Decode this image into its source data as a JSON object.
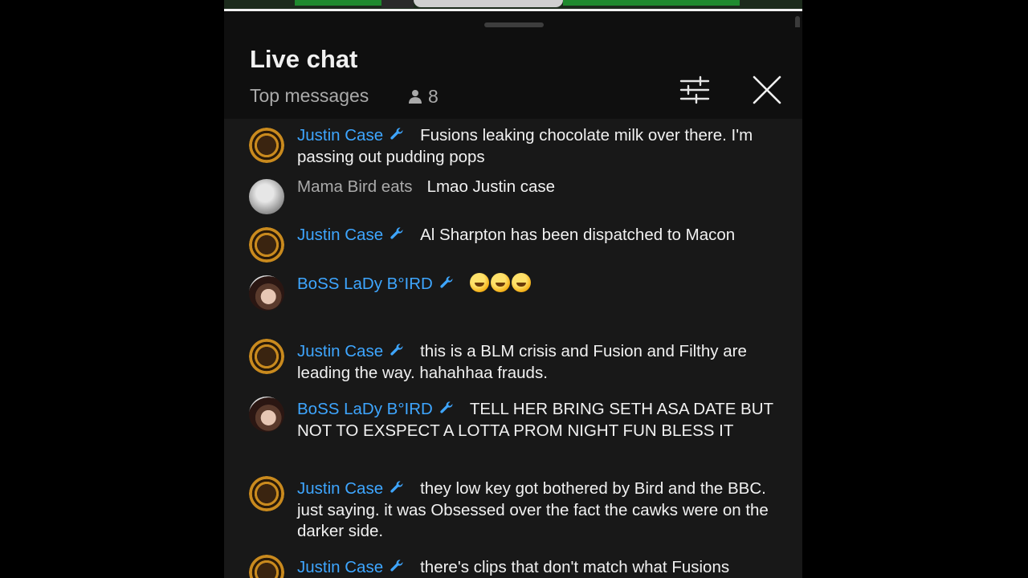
{
  "header": {
    "title": "Live chat",
    "subtitle": "Top messages",
    "viewer_count": "8"
  },
  "icons": {
    "viewers": "person-icon",
    "filter": "sliders-icon",
    "close": "close-icon",
    "moderator": "wrench-icon"
  },
  "colors": {
    "moderator_name": "#3ea6ff",
    "regular_name": "#aaaaaa",
    "message_text": "#f1f1f1",
    "background": "#0f0f0f"
  },
  "messages": [
    {
      "author": "Justin Case",
      "moderator": true,
      "text": "Fusions leaking chocolate milk over there. I'm passing out pudding pops"
    },
    {
      "author": "Mama Bird eats",
      "moderator": false,
      "text": "Lmao Justin case"
    },
    {
      "author": "Justin Case",
      "moderator": true,
      "text": "Al Sharpton has been dispatched to Macon"
    },
    {
      "author": "BoSS LaDy B°IRD",
      "moderator": true,
      "text": "",
      "emoji_count": 3
    },
    {
      "author": "Justin Case",
      "moderator": true,
      "text": "this is a BLM crisis and Fusion and Filthy are leading the way. hahahhaa frauds."
    },
    {
      "author": "BoSS LaDy B°IRD",
      "moderator": true,
      "text": "TELL HER BRING SETH ASA DATE BUT NOT TO EXSPECT A LOTTA PROM NIGHT FUN BLESS IT"
    },
    {
      "author": "Justin Case",
      "moderator": true,
      "text": "they low key got bothered by Bird and the BBC. just saying. it was Obsessed over the fact the cawks were on the darker side."
    },
    {
      "author": "Justin Case",
      "moderator": true,
      "text": "there's clips that don't match what Fusions saying now. just cause they don't say the word doesn't mean"
    }
  ]
}
